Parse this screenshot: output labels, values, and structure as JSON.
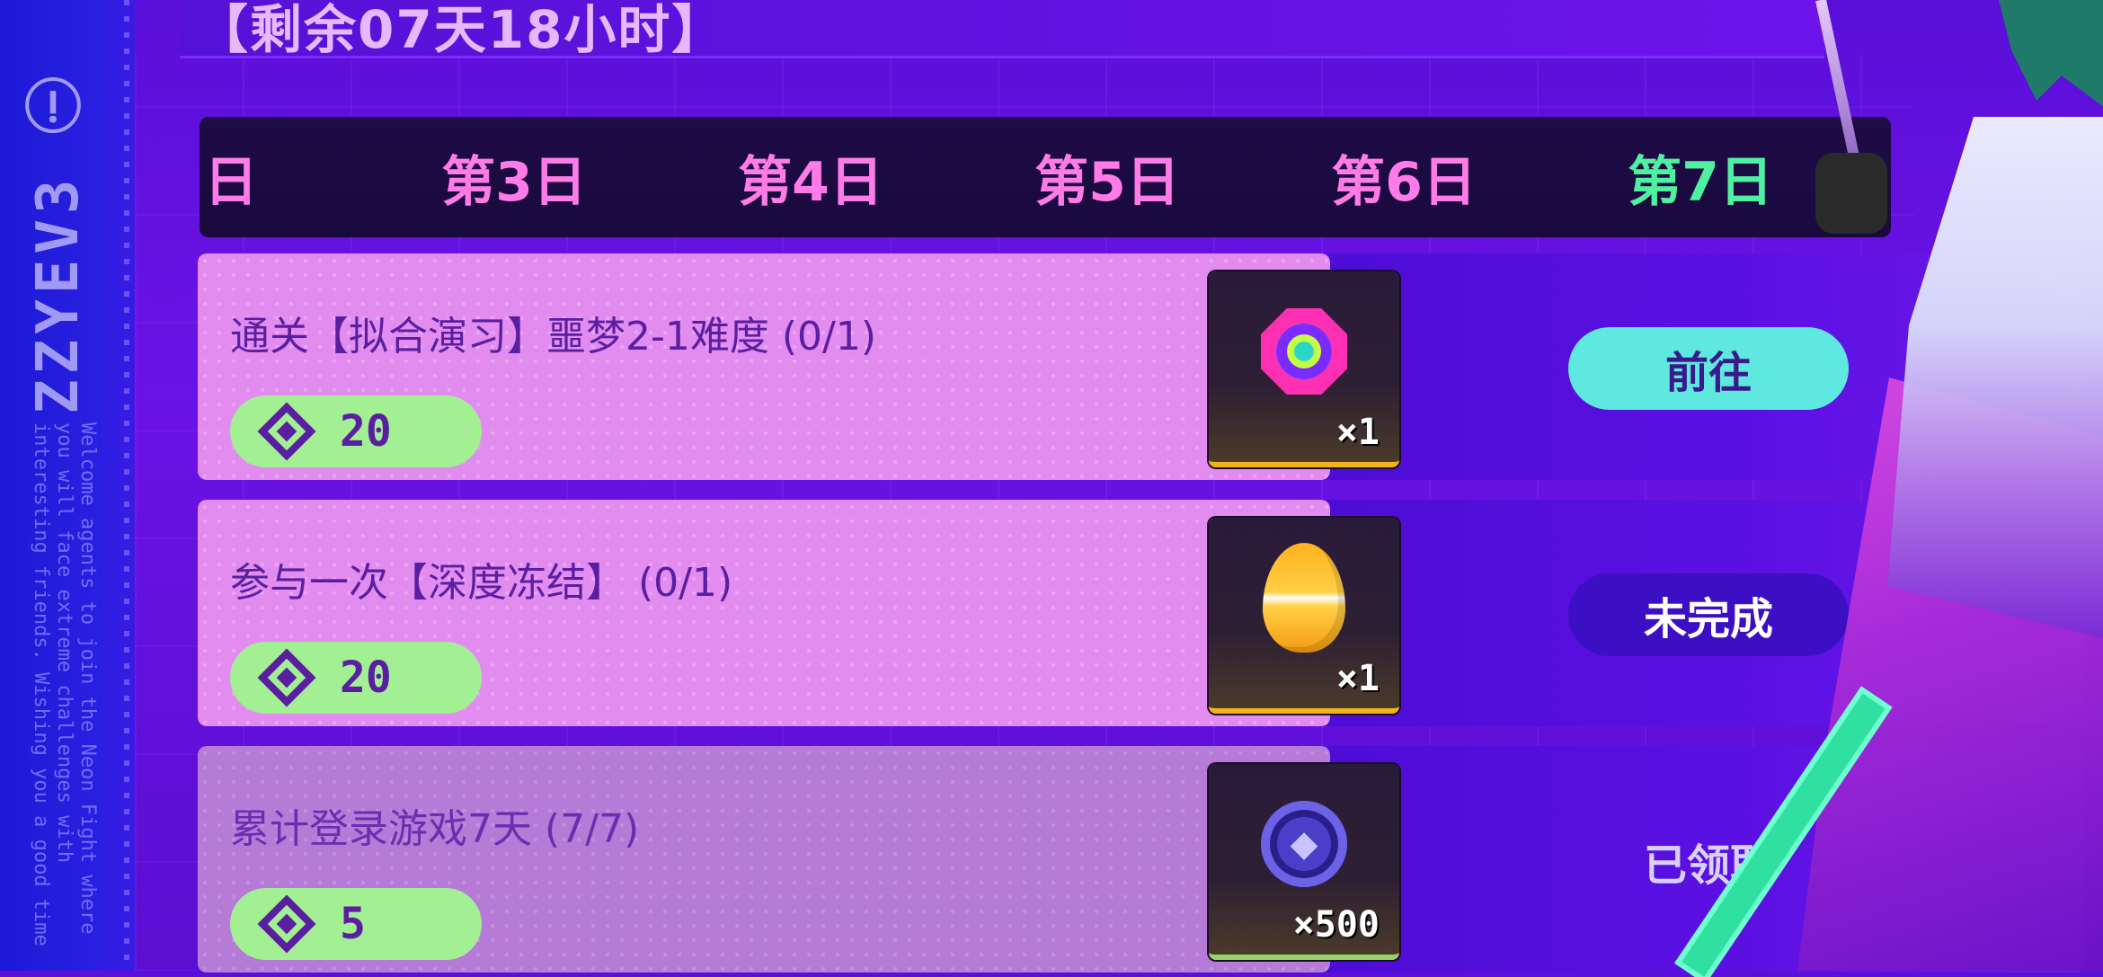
{
  "banner": {
    "remaining": "【剩余07天18小时】"
  },
  "side": {
    "logo": "ZZYEV3 ⓘ",
    "blurb": "Welcome agents to join the Neon Fight where you will face extreme challenges with interesting friends. Wishing you a good time"
  },
  "days": [
    {
      "label": "日",
      "active": false
    },
    {
      "label": "第3日",
      "active": false
    },
    {
      "label": "第4日",
      "active": false
    },
    {
      "label": "第5日",
      "active": false
    },
    {
      "label": "第6日",
      "active": false
    },
    {
      "label": "第7日",
      "active": true
    }
  ],
  "tasks": [
    {
      "desc": "通关【拟合演习】噩梦2-1难度 (0/1)",
      "points": "20",
      "reward_icon": "octagon-target-icon",
      "reward_qty": "×1",
      "button": "前往",
      "state": "go"
    },
    {
      "desc": "参与一次【深度冻结】 (0/1)",
      "points": "20",
      "reward_icon": "egg-icon",
      "reward_qty": "×1",
      "button": "未完成",
      "state": "todo"
    },
    {
      "desc": "累计登录游戏7天 (7/7)",
      "points": "5",
      "reward_icon": "coin-icon",
      "reward_qty": "×500",
      "button": "已领取",
      "state": "claimed"
    }
  ],
  "colors": {
    "accent_green": "#4ff0a0",
    "day_pink": "#ff7be7",
    "go_button": "#5ee8e0",
    "todo_button": "#3d0fc4"
  }
}
